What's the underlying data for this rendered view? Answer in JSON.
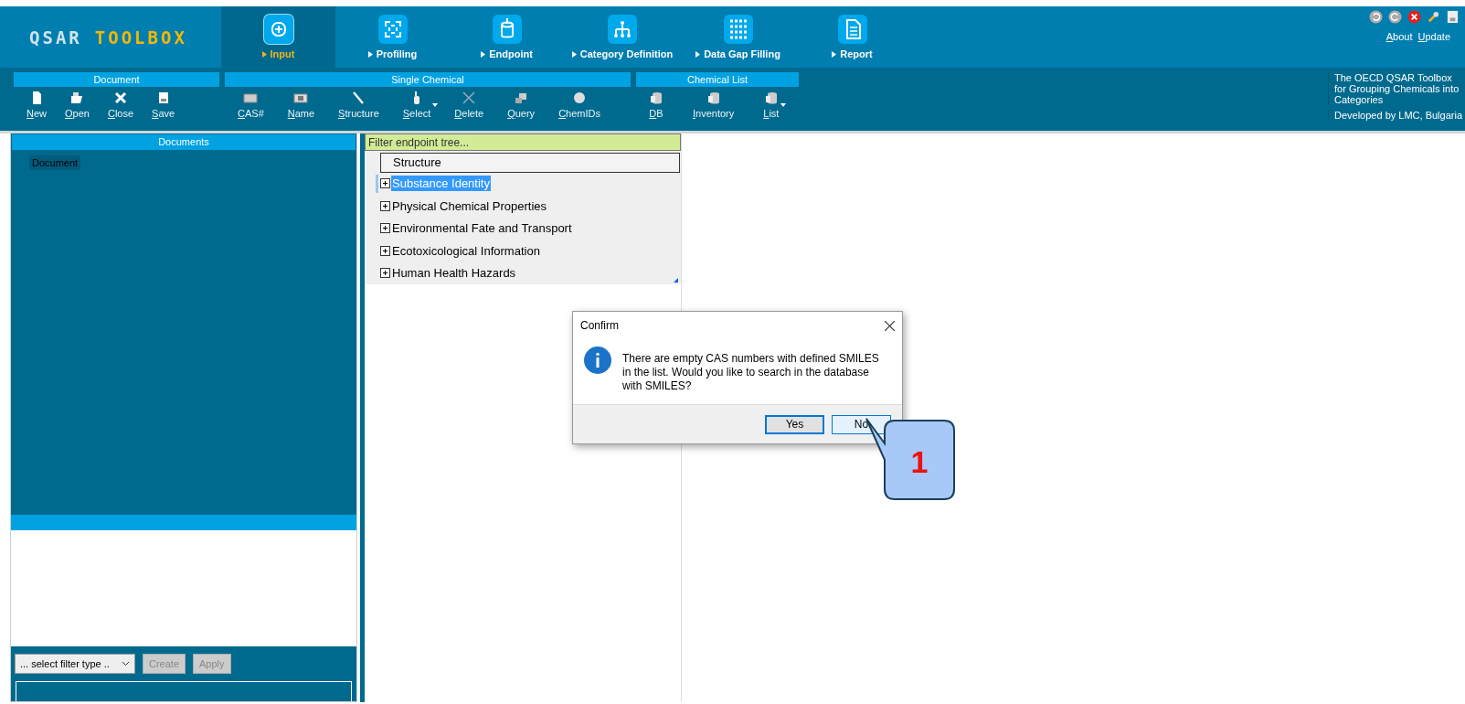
{
  "logo": {
    "part1": "QSAR",
    "part2": "TOOLBOX"
  },
  "nav_tabs": [
    {
      "label": "Input",
      "selected": true
    },
    {
      "label": "Profiling",
      "selected": false
    },
    {
      "label": "Endpoint",
      "selected": false
    },
    {
      "label": "Category Definition",
      "selected": false
    },
    {
      "label": "Data Gap Filling",
      "selected": false
    },
    {
      "label": "Report",
      "selected": false
    }
  ],
  "top_links": [
    "About",
    "Update"
  ],
  "toolbar_groups": [
    {
      "title": "Document",
      "items": [
        {
          "label": "New",
          "kind": "button"
        },
        {
          "label": "Open",
          "kind": "button"
        },
        {
          "label": "Close",
          "kind": "button"
        },
        {
          "label": "Save",
          "kind": "button"
        }
      ]
    },
    {
      "title": "Single Chemical",
      "items": [
        {
          "label": "CAS#",
          "kind": "button"
        },
        {
          "label": "Name",
          "kind": "button"
        },
        {
          "label": "Structure",
          "kind": "button"
        },
        {
          "label": "Select",
          "kind": "dropdown"
        },
        {
          "label": "Delete",
          "kind": "button"
        },
        {
          "label": "Query",
          "kind": "button"
        },
        {
          "label": "ChemIDs",
          "kind": "button"
        }
      ]
    },
    {
      "title": "Chemical List",
      "items": [
        {
          "label": "DB",
          "kind": "button"
        },
        {
          "label": "Inventory",
          "kind": "button"
        },
        {
          "label": "List",
          "kind": "dropdown"
        }
      ]
    }
  ],
  "info": {
    "description": "The OECD QSAR Toolbox for Grouping Chemicals into Categories",
    "developer": "Developed by LMC, Bulgaria"
  },
  "documents": {
    "title": "Documents",
    "items": [
      {
        "label": "Document",
        "selected": true
      }
    ],
    "filter_select": {
      "value": "... select filter type .."
    },
    "buttons": [
      {
        "label": "Create",
        "disabled": true
      },
      {
        "label": "Apply",
        "disabled": true
      }
    ]
  },
  "endpoint_tree": {
    "filter": {
      "placeholder": "Filter endpoint tree..."
    },
    "header": "Structure",
    "items": [
      {
        "label": "Substance Identity",
        "selected": true
      },
      {
        "label": "Physical Chemical Properties",
        "selected": false
      },
      {
        "label": "Environmental Fate and Transport",
        "selected": false
      },
      {
        "label": "Ecotoxicological Information",
        "selected": false
      },
      {
        "label": "Human Health Hazards",
        "selected": false
      }
    ]
  },
  "dialog": {
    "title": "Confirm",
    "message": "There are empty CAS numbers with defined SMILES in the list. Would you like to search in the database with SMILES?",
    "buttons": [
      {
        "label": "Yes",
        "selected": true
      },
      {
        "label": "No",
        "selected": false
      }
    ]
  },
  "callout": {
    "number": "1"
  }
}
